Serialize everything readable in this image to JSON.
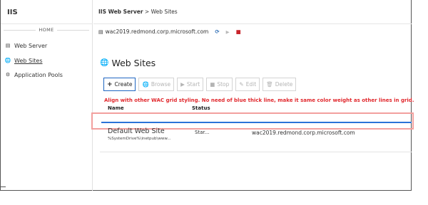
{
  "app": {
    "title": "IIS"
  },
  "sidebar": {
    "section_label": "HOME",
    "items": [
      {
        "label": "Web Server",
        "icon": "server-icon",
        "active": false
      },
      {
        "label": "Web Sites",
        "icon": "globe-icon",
        "active": true
      },
      {
        "label": "Application Pools",
        "icon": "gears-icon",
        "active": false
      }
    ]
  },
  "breadcrumb": {
    "root": "IIS Web Server",
    "separator": ">",
    "current": "Web Sites"
  },
  "server": {
    "name": "wac2019.redmond.corp.microsoft.com",
    "icon": "server-icon",
    "actions": [
      "refresh-icon",
      "play-icon",
      "stop-icon"
    ]
  },
  "page": {
    "title": "Web Sites",
    "icon": "globe-icon"
  },
  "toolbar": {
    "create": "Create",
    "browse": "Browse",
    "start": "Start",
    "stop": "Stop",
    "edit": "Edit",
    "delete": "Delete"
  },
  "annotation": {
    "text": "Align with other WAC grid styling. No need of blue thick line, make it same color weight as other lines in grid.",
    "color": "#e1282d"
  },
  "grid": {
    "columns": [
      "Name",
      "Status"
    ],
    "rows": [
      {
        "name": "Default Web Site",
        "path": "%SystemDrive%\\inetpub\\www...",
        "status": "Star...",
        "binding": "wac2019.redmond.corp.microsoft.com"
      }
    ]
  },
  "colors": {
    "accent": "#1f66c1",
    "blue_line": "#2b73d8",
    "stop": "#c8242b",
    "highlight": "#f2a09e"
  }
}
